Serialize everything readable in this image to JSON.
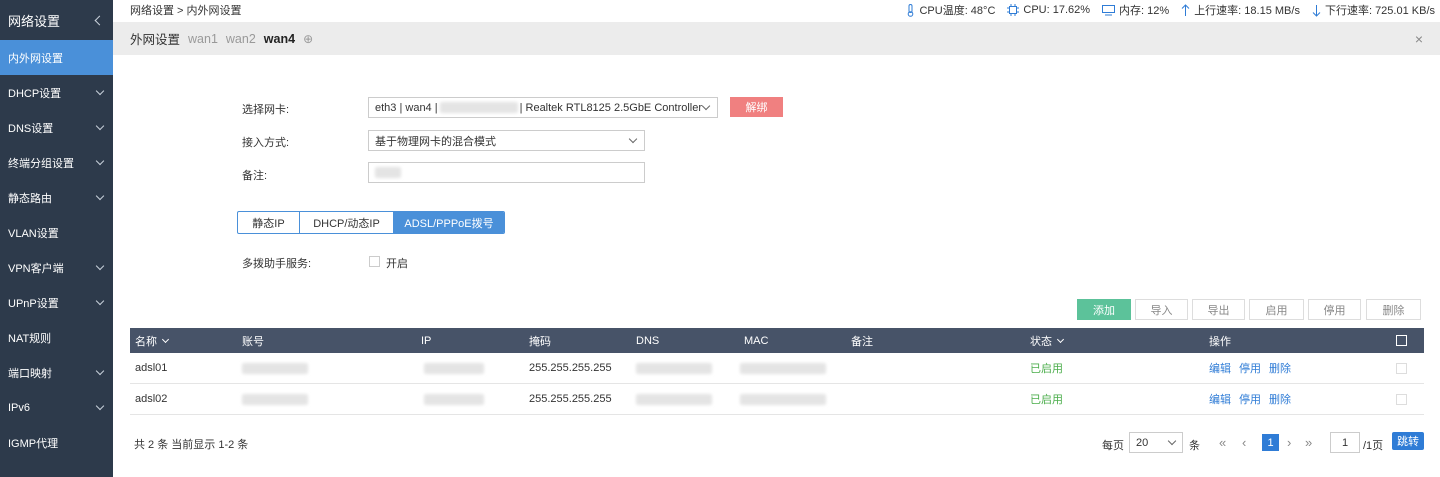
{
  "sidebar": {
    "title": "网络设置",
    "items": [
      {
        "label": "内外网设置",
        "active": true,
        "expandable": false
      },
      {
        "label": "DHCP设置",
        "expandable": true
      },
      {
        "label": "DNS设置",
        "expandable": true
      },
      {
        "label": "终端分组设置",
        "expandable": true
      },
      {
        "label": "静态路由",
        "expandable": true
      },
      {
        "label": "VLAN设置",
        "expandable": false
      },
      {
        "label": "VPN客户端",
        "expandable": true
      },
      {
        "label": "UPnP设置",
        "expandable": true
      },
      {
        "label": "NAT规则",
        "expandable": false
      },
      {
        "label": "端口映射",
        "expandable": true
      },
      {
        "label": "IPv6",
        "expandable": true
      },
      {
        "label": "IGMP代理",
        "expandable": false
      }
    ]
  },
  "topbar": {
    "breadcrumb": "网络设置 > 内外网设置",
    "cpu_temp": "CPU温度: 48°C",
    "cpu": "CPU: 17.62%",
    "mem": "内存: 12%",
    "up": "上行速率: 18.15 MB/s",
    "down": "下行速率: 725.01 KB/s"
  },
  "tabs": {
    "title": "外网设置",
    "items": [
      "wan1",
      "wan2",
      "wan4"
    ],
    "current": "wan4",
    "add": "⊕",
    "close": "×"
  },
  "form": {
    "nic_label": "选择网卡:",
    "nic_prefix": "eth3 | wan4 |",
    "nic_suffix": "| Realtek RTL8125 2.5GbE Controller",
    "unbind": "解绑",
    "mode_label": "接入方式:",
    "mode_value": "基于物理网卡的混合模式",
    "note_label": "备注:",
    "seg": [
      "静态IP",
      "DHCP/动态IP",
      "ADSL/PPPoE拨号"
    ],
    "seg_active": 2,
    "helper_label": "多拨助手服务:",
    "helper_option": "开启"
  },
  "toolbar": {
    "add": "添加",
    "import": "导入",
    "export": "导出",
    "enable": "启用",
    "disable": "停用",
    "delete": "删除"
  },
  "table": {
    "headers": {
      "name": "名称",
      "account": "账号",
      "ip": "IP",
      "mask": "掩码",
      "dns": "DNS",
      "mac": "MAC",
      "note": "备注",
      "status": "状态",
      "ops": "操作"
    },
    "rows": [
      {
        "name": "adsl01",
        "mask": "255.255.255.255",
        "status": "已启用",
        "edit": "编辑",
        "stop": "停用",
        "del": "删除"
      },
      {
        "name": "adsl02",
        "mask": "255.255.255.255",
        "status": "已启用",
        "edit": "编辑",
        "stop": "停用",
        "del": "删除"
      }
    ]
  },
  "pagination": {
    "summary": "共 2 条 当前显示 1-2 条",
    "per_page_label": "每页",
    "per_page": "20",
    "unit": "条",
    "current": "1",
    "input": "1",
    "total_pages": "/1页",
    "jump": "跳转"
  },
  "colors": {
    "sidebar_bg": "#2d3a4b",
    "accent": "#4a90d9",
    "danger": "#f08080",
    "success": "#5cc29a",
    "table_head": "#475368"
  }
}
